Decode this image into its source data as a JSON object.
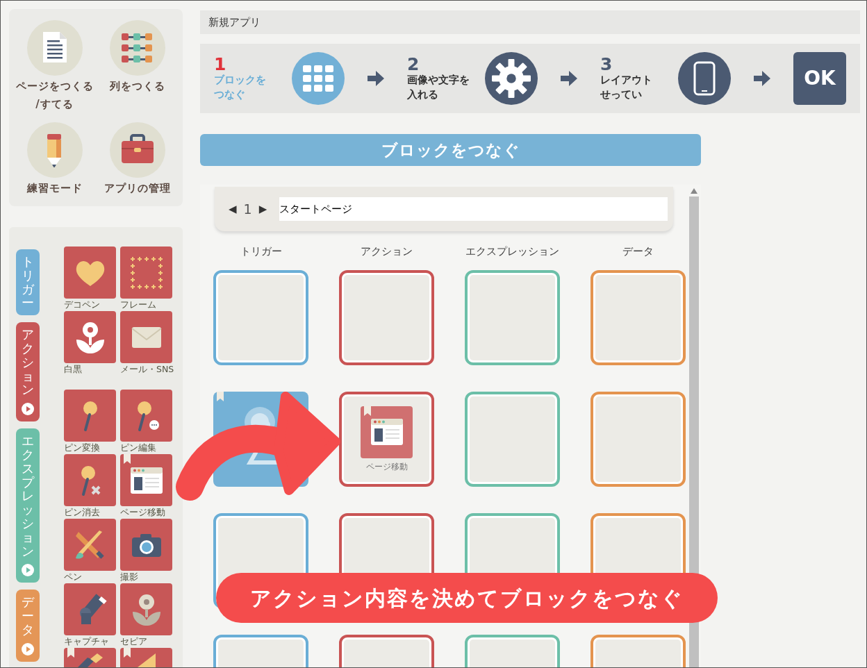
{
  "menu": [
    {
      "lines": [
        "ページをつくる",
        "/すてる"
      ],
      "kind": "page"
    },
    {
      "lines": [
        "列をつくる"
      ],
      "kind": "columns"
    },
    {
      "lines": [
        "練習モード"
      ],
      "kind": "pencil"
    },
    {
      "lines": [
        "アプリの管理"
      ],
      "kind": "toolbox"
    }
  ],
  "categories": [
    {
      "label": "トリガー",
      "color": "#72b0d6",
      "play": false
    },
    {
      "label": "アクション",
      "color": "#c75757",
      "play": true
    },
    {
      "label": "エクスプレッション",
      "color": "#6cbfa8",
      "play": true
    },
    {
      "label": "データ",
      "color": "#e49657",
      "play": true
    }
  ],
  "palette_groups": [
    [
      {
        "label": "デコペン",
        "kind": "heart",
        "bookmark": false
      },
      {
        "label": "フレーム",
        "kind": "frame",
        "bookmark": false
      },
      {
        "label": "白黒",
        "kind": "flower",
        "bookmark": false
      },
      {
        "label": "メール・SNS",
        "kind": "envelope",
        "bookmark": false
      }
    ],
    [
      {
        "label": "ピン変換",
        "kind": "pin",
        "bookmark": false
      },
      {
        "label": "ピン編集",
        "kind": "pin-bubble",
        "bookmark": false
      },
      {
        "label": "ピン消去",
        "kind": "pin-x",
        "bookmark": false
      },
      {
        "label": "ページ移動",
        "kind": "browser",
        "bookmark": true
      },
      {
        "label": "ペン",
        "kind": "pen-brush",
        "bookmark": false
      },
      {
        "label": "撮影",
        "kind": "camera",
        "bookmark": false
      },
      {
        "label": "キャプチャ",
        "kind": "capture",
        "bookmark": false
      },
      {
        "label": "セピア",
        "kind": "sepia",
        "bookmark": false
      },
      {
        "kind": "fragment-a",
        "bookmark": true
      },
      {
        "kind": "fragment-b",
        "bookmark": true
      }
    ]
  ],
  "app_title": "新規アプリ",
  "steps": [
    {
      "number": "1",
      "lines": [
        "ブロックを",
        "つなぐ"
      ],
      "kind": "blocks",
      "active": true
    },
    {
      "number": "2",
      "lines": [
        "画像や文字を",
        "入れる"
      ],
      "kind": "gear",
      "active": false
    },
    {
      "number": "3",
      "lines": [
        "レイアウト",
        "せってい"
      ],
      "kind": "phone",
      "active": false
    }
  ],
  "ok_button": "OK",
  "section_title": "ブロックをつなぐ",
  "page_nav": {
    "prev": "◀",
    "number": "1",
    "next": "▶",
    "title": "スタートページ"
  },
  "columns": [
    {
      "name": "トリガー",
      "color": "#6aaed6"
    },
    {
      "name": "アクション",
      "color": "#c95454"
    },
    {
      "name": "エクスプレッション",
      "color": "#6cbfa8"
    },
    {
      "name": "データ",
      "color": "#e4944f"
    }
  ],
  "rows": [
    [
      {
        "kind": "empty"
      },
      {
        "kind": "empty"
      },
      {
        "kind": "empty"
      },
      {
        "kind": "empty"
      }
    ],
    [
      {
        "kind": "touch-block",
        "bookmark": true
      },
      {
        "kind": "action-block",
        "label": "ページ移動",
        "bookmark": true
      },
      {
        "kind": "empty"
      },
      {
        "kind": "empty"
      }
    ],
    [
      {
        "kind": "empty"
      },
      {
        "kind": "empty"
      },
      {
        "kind": "empty"
      },
      {
        "kind": "empty"
      }
    ],
    [
      {
        "kind": "empty"
      },
      {
        "kind": "empty"
      },
      {
        "kind": "empty"
      },
      {
        "kind": "empty"
      }
    ]
  ],
  "callout": "アクション内容を決めてブロックをつなぐ"
}
